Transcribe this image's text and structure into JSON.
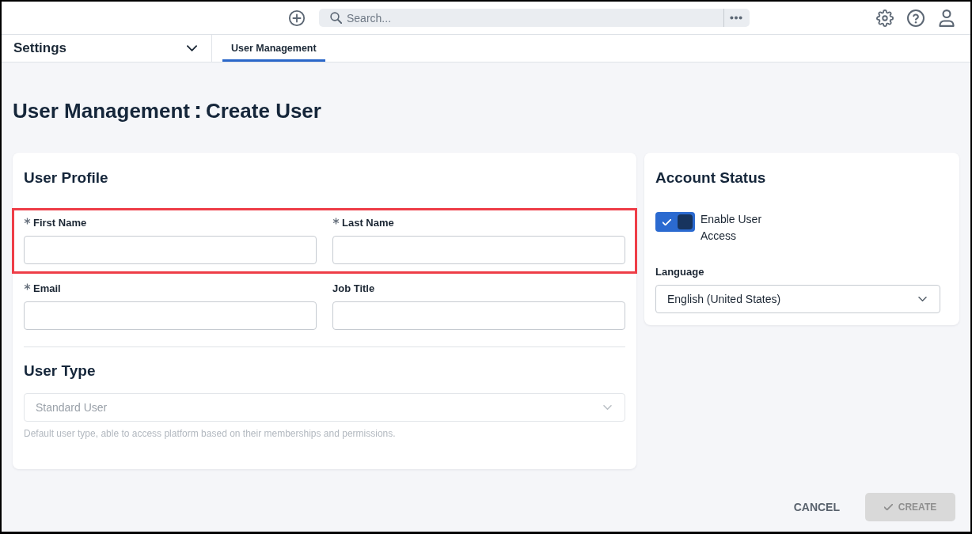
{
  "top_bar": {
    "search": {
      "placeholder": "Search..."
    }
  },
  "nav": {
    "section_menu": {
      "label": "Settings"
    },
    "tabs": [
      {
        "label": "User Management",
        "selected": true
      }
    ]
  },
  "page_title": {
    "parent": "User Management",
    "separator": ":",
    "title": "Create User"
  },
  "user_profile": {
    "title": "User Profile",
    "rows": [
      {
        "highlighted": true,
        "fields": [
          {
            "label": "First Name",
            "required": true
          },
          {
            "label": "Last Name",
            "required": true
          }
        ]
      },
      {
        "highlighted": false,
        "fields": [
          {
            "label": "Email",
            "required": true
          },
          {
            "label": "Job Title",
            "required": false
          }
        ]
      }
    ]
  },
  "user_type": {
    "title": "User Type",
    "select": {
      "value": "Standard User",
      "disabled": true
    },
    "help": "Default user type, able to access platform based on their memberships and permissions."
  },
  "account_status": {
    "title": "Account Status",
    "toggle": {
      "label": "Enable User Access",
      "on": true
    },
    "language": {
      "label": "Language",
      "value": "English (United States)"
    }
  },
  "actions": [
    {
      "label": "CANCEL",
      "kind": "text",
      "disabled": false
    },
    {
      "label": "CREATE",
      "kind": "primary",
      "disabled": true
    }
  ]
}
